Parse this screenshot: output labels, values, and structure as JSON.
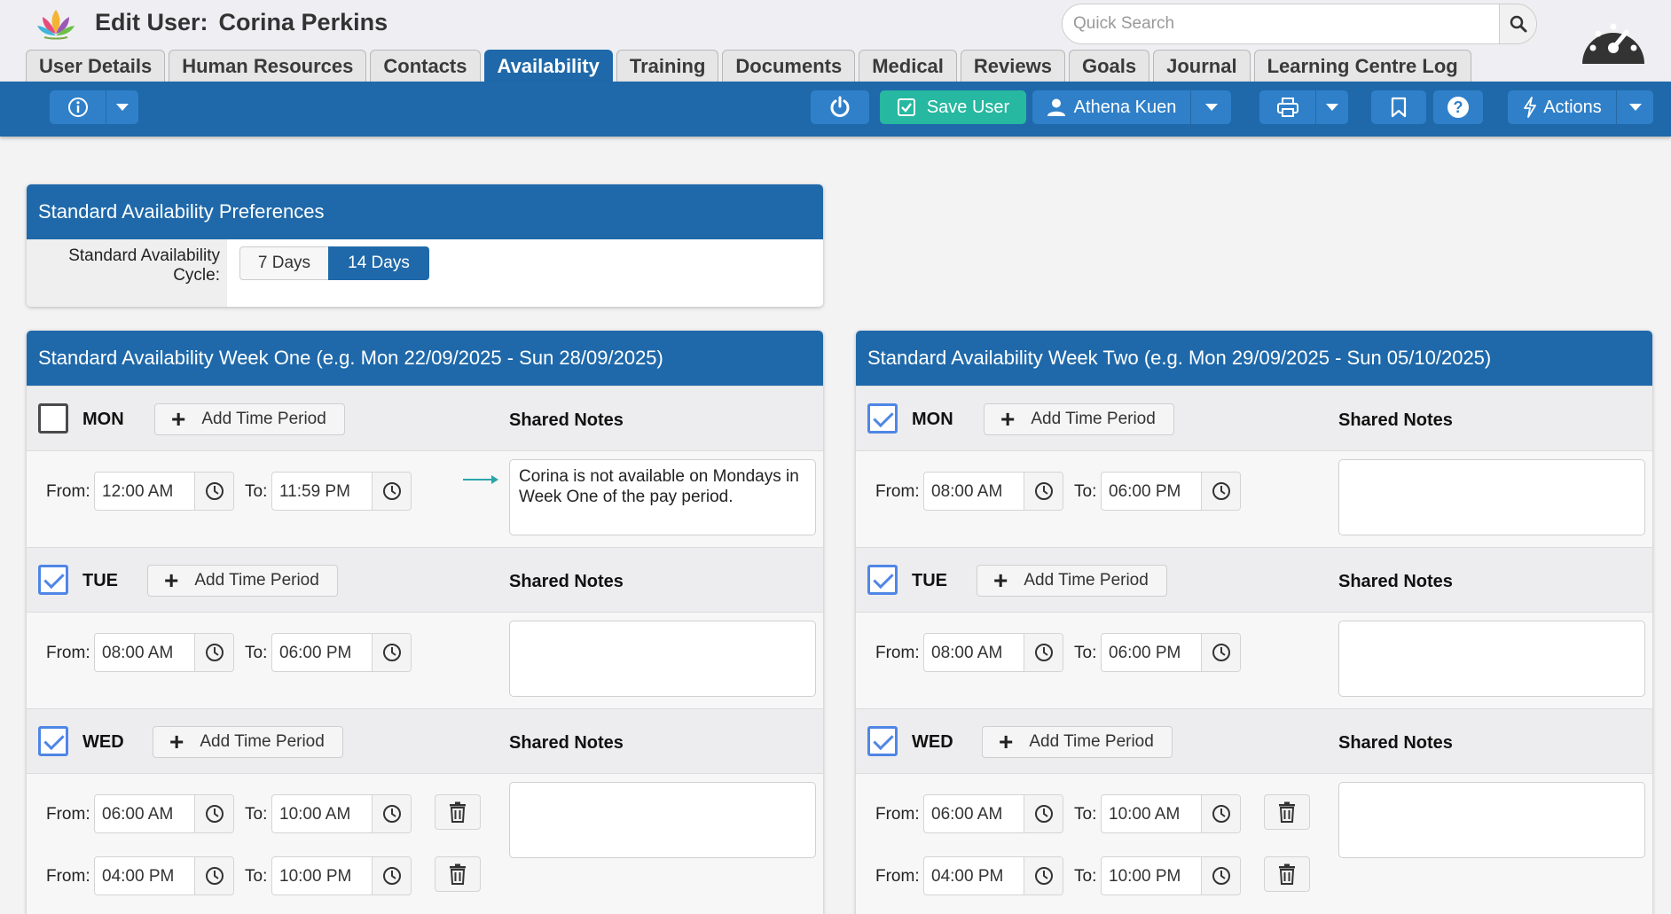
{
  "header": {
    "title_prefix": "Edit User:",
    "user_name": "Corina Perkins",
    "search_placeholder": "Quick Search"
  },
  "tabs": [
    {
      "label": "User Details",
      "active": false
    },
    {
      "label": "Human Resources",
      "active": false
    },
    {
      "label": "Contacts",
      "active": false
    },
    {
      "label": "Availability",
      "active": true
    },
    {
      "label": "Training",
      "active": false
    },
    {
      "label": "Documents",
      "active": false
    },
    {
      "label": "Medical",
      "active": false
    },
    {
      "label": "Reviews",
      "active": false
    },
    {
      "label": "Goals",
      "active": false
    },
    {
      "label": "Journal",
      "active": false
    },
    {
      "label": "Learning Centre Log",
      "active": false
    }
  ],
  "toolbar": {
    "save_label": "Save User",
    "current_user": "Athena Kuen",
    "actions_label": "Actions"
  },
  "preferences": {
    "title": "Standard Availability Preferences",
    "cycle_label": "Standard Availability Cycle:",
    "options": [
      "7 Days",
      "14 Days"
    ],
    "selected": "14 Days"
  },
  "labels": {
    "add_time_period": "Add Time Period",
    "shared_notes": "Shared Notes",
    "from": "From:",
    "to": "To:"
  },
  "week_one": {
    "title": "Standard Availability Week One (e.g. Mon 22/09/2025 - Sun 28/09/2025)",
    "days": {
      "mon": {
        "name": "MON",
        "checked": false,
        "periods": [
          {
            "from": "12:00 AM",
            "to": "11:59 PM"
          }
        ],
        "notes": "Corina is not available on Mondays in Week One of the pay period."
      },
      "tue": {
        "name": "TUE",
        "checked": true,
        "periods": [
          {
            "from": "08:00 AM",
            "to": "06:00 PM"
          }
        ],
        "notes": ""
      },
      "wed": {
        "name": "WED",
        "checked": true,
        "periods": [
          {
            "from": "06:00 AM",
            "to": "10:00 AM"
          },
          {
            "from": "04:00 PM",
            "to": "10:00 PM"
          }
        ],
        "notes": ""
      }
    }
  },
  "week_two": {
    "title": "Standard Availability Week Two (e.g. Mon 29/09/2025 - Sun 05/10/2025)",
    "days": {
      "mon": {
        "name": "MON",
        "checked": true,
        "periods": [
          {
            "from": "08:00 AM",
            "to": "06:00 PM"
          }
        ],
        "notes": ""
      },
      "tue": {
        "name": "TUE",
        "checked": true,
        "periods": [
          {
            "from": "08:00 AM",
            "to": "06:00 PM"
          }
        ],
        "notes": ""
      },
      "wed": {
        "name": "WED",
        "checked": true,
        "periods": [
          {
            "from": "06:00 AM",
            "to": "10:00 AM"
          },
          {
            "from": "04:00 PM",
            "to": "10:00 PM"
          }
        ],
        "notes": ""
      }
    }
  },
  "colors": {
    "brand_blue": "#1f69aa",
    "toolbar_button": "#2f80c9",
    "save_green": "#26b8a0",
    "checkbox_blue": "#4f86e6"
  }
}
